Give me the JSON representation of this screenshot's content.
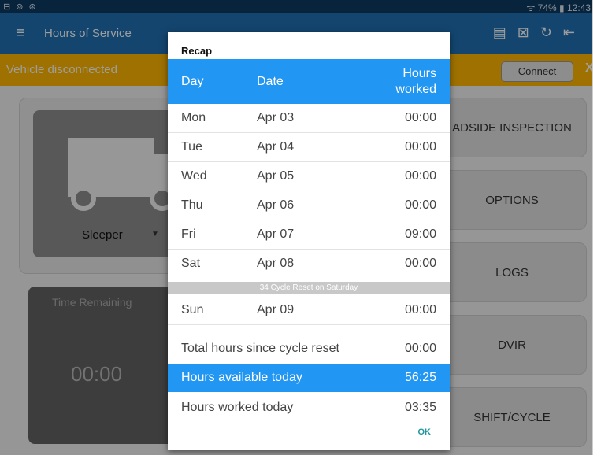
{
  "status_bar": {
    "left_icons": "⊟ ⊚ ⊛",
    "right_text": "ᯤ 74% ▮ 12:43"
  },
  "appbar": {
    "title": "Hours of Service",
    "menu_icon": "menu-icon",
    "icons": [
      "message-icon",
      "document-icon",
      "refresh-icon",
      "logout-icon"
    ]
  },
  "banner": {
    "message": "Vehicle disconnected",
    "connect_label": "Connect",
    "close_label": "X"
  },
  "duty": {
    "status": "Sleeper"
  },
  "time_remaining": {
    "label": "Time Remaining",
    "value": "00:00"
  },
  "right_buttons": [
    "ADSIDE INSPECTION",
    "OPTIONS",
    "LOGS",
    "DVIR",
    "SHIFT/CYCLE"
  ],
  "recap": {
    "title": "Recap",
    "headers": {
      "day": "Day",
      "date": "Date",
      "hours": "Hours worked"
    },
    "rows": [
      {
        "day": "Mon",
        "date": "Apr 03",
        "hours": "00:00"
      },
      {
        "day": "Tue",
        "date": "Apr 04",
        "hours": "00:00"
      },
      {
        "day": "Wed",
        "date": "Apr 05",
        "hours": "00:00"
      },
      {
        "day": "Thu",
        "date": "Apr 06",
        "hours": "00:00"
      },
      {
        "day": "Fri",
        "date": "Apr 07",
        "hours": "09:00"
      },
      {
        "day": "Sat",
        "date": "Apr 08",
        "hours": "00:00"
      }
    ],
    "reset_note": "34 Cycle Reset on Saturday",
    "last_row": {
      "day": "Sun",
      "date": "Apr 09",
      "hours": "00:00"
    },
    "total_label": "Total hours since cycle reset",
    "total_value": "00:00",
    "available_label": "Hours available today",
    "available_value": "56:25",
    "worked_label": "Hours worked today",
    "worked_value": "03:35",
    "ok_label": "OK"
  },
  "colors": {
    "appbar": "#1f70b3",
    "banner": "#ffb700",
    "accent": "#2196f3"
  }
}
